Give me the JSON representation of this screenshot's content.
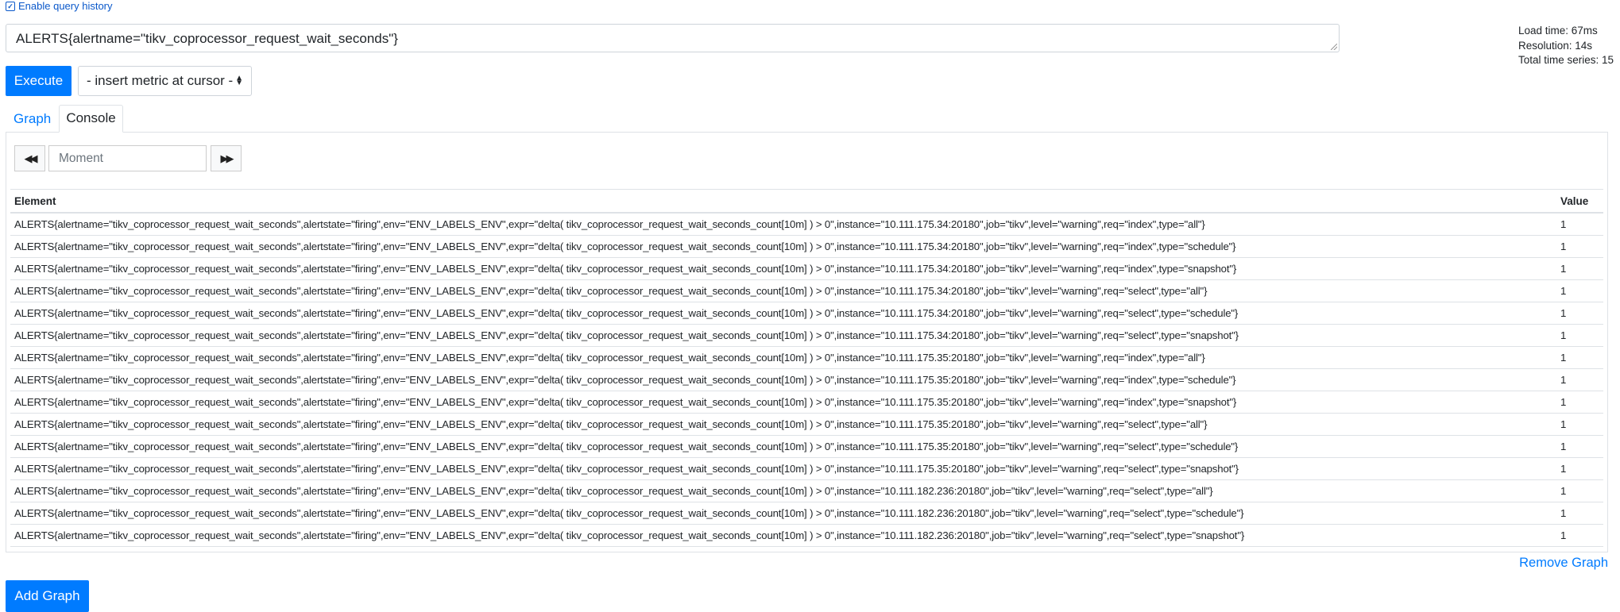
{
  "history": {
    "label": "Enable query history",
    "checked": true
  },
  "query": {
    "expression": "ALERTS{alertname=\"tikv_coprocessor_request_wait_seconds\"}"
  },
  "stats": {
    "load_time": "Load time: 67ms",
    "resolution": "Resolution: 14s",
    "total_series": "Total time series: 15"
  },
  "toolbar": {
    "execute_label": "Execute",
    "metric_select": "- insert metric at cursor -"
  },
  "tabs": [
    {
      "label": "Graph",
      "active": false
    },
    {
      "label": "Console",
      "active": true
    }
  ],
  "console": {
    "moment_placeholder": "Moment",
    "columns": [
      "Element",
      "Value"
    ],
    "rows": [
      {
        "element": "ALERTS{alertname=\"tikv_coprocessor_request_wait_seconds\",alertstate=\"firing\",env=\"ENV_LABELS_ENV\",expr=\"delta( tikv_coprocessor_request_wait_seconds_count[10m] ) > 0\",instance=\"10.111.175.34:20180\",job=\"tikv\",level=\"warning\",req=\"index\",type=\"all\"}",
        "value": "1"
      },
      {
        "element": "ALERTS{alertname=\"tikv_coprocessor_request_wait_seconds\",alertstate=\"firing\",env=\"ENV_LABELS_ENV\",expr=\"delta( tikv_coprocessor_request_wait_seconds_count[10m] ) > 0\",instance=\"10.111.175.34:20180\",job=\"tikv\",level=\"warning\",req=\"index\",type=\"schedule\"}",
        "value": "1"
      },
      {
        "element": "ALERTS{alertname=\"tikv_coprocessor_request_wait_seconds\",alertstate=\"firing\",env=\"ENV_LABELS_ENV\",expr=\"delta( tikv_coprocessor_request_wait_seconds_count[10m] ) > 0\",instance=\"10.111.175.34:20180\",job=\"tikv\",level=\"warning\",req=\"index\",type=\"snapshot\"}",
        "value": "1"
      },
      {
        "element": "ALERTS{alertname=\"tikv_coprocessor_request_wait_seconds\",alertstate=\"firing\",env=\"ENV_LABELS_ENV\",expr=\"delta( tikv_coprocessor_request_wait_seconds_count[10m] ) > 0\",instance=\"10.111.175.34:20180\",job=\"tikv\",level=\"warning\",req=\"select\",type=\"all\"}",
        "value": "1"
      },
      {
        "element": "ALERTS{alertname=\"tikv_coprocessor_request_wait_seconds\",alertstate=\"firing\",env=\"ENV_LABELS_ENV\",expr=\"delta( tikv_coprocessor_request_wait_seconds_count[10m] ) > 0\",instance=\"10.111.175.34:20180\",job=\"tikv\",level=\"warning\",req=\"select\",type=\"schedule\"}",
        "value": "1"
      },
      {
        "element": "ALERTS{alertname=\"tikv_coprocessor_request_wait_seconds\",alertstate=\"firing\",env=\"ENV_LABELS_ENV\",expr=\"delta( tikv_coprocessor_request_wait_seconds_count[10m] ) > 0\",instance=\"10.111.175.34:20180\",job=\"tikv\",level=\"warning\",req=\"select\",type=\"snapshot\"}",
        "value": "1"
      },
      {
        "element": "ALERTS{alertname=\"tikv_coprocessor_request_wait_seconds\",alertstate=\"firing\",env=\"ENV_LABELS_ENV\",expr=\"delta( tikv_coprocessor_request_wait_seconds_count[10m] ) > 0\",instance=\"10.111.175.35:20180\",job=\"tikv\",level=\"warning\",req=\"index\",type=\"all\"}",
        "value": "1"
      },
      {
        "element": "ALERTS{alertname=\"tikv_coprocessor_request_wait_seconds\",alertstate=\"firing\",env=\"ENV_LABELS_ENV\",expr=\"delta( tikv_coprocessor_request_wait_seconds_count[10m] ) > 0\",instance=\"10.111.175.35:20180\",job=\"tikv\",level=\"warning\",req=\"index\",type=\"schedule\"}",
        "value": "1"
      },
      {
        "element": "ALERTS{alertname=\"tikv_coprocessor_request_wait_seconds\",alertstate=\"firing\",env=\"ENV_LABELS_ENV\",expr=\"delta( tikv_coprocessor_request_wait_seconds_count[10m] ) > 0\",instance=\"10.111.175.35:20180\",job=\"tikv\",level=\"warning\",req=\"index\",type=\"snapshot\"}",
        "value": "1"
      },
      {
        "element": "ALERTS{alertname=\"tikv_coprocessor_request_wait_seconds\",alertstate=\"firing\",env=\"ENV_LABELS_ENV\",expr=\"delta( tikv_coprocessor_request_wait_seconds_count[10m] ) > 0\",instance=\"10.111.175.35:20180\",job=\"tikv\",level=\"warning\",req=\"select\",type=\"all\"}",
        "value": "1"
      },
      {
        "element": "ALERTS{alertname=\"tikv_coprocessor_request_wait_seconds\",alertstate=\"firing\",env=\"ENV_LABELS_ENV\",expr=\"delta( tikv_coprocessor_request_wait_seconds_count[10m] ) > 0\",instance=\"10.111.175.35:20180\",job=\"tikv\",level=\"warning\",req=\"select\",type=\"schedule\"}",
        "value": "1"
      },
      {
        "element": "ALERTS{alertname=\"tikv_coprocessor_request_wait_seconds\",alertstate=\"firing\",env=\"ENV_LABELS_ENV\",expr=\"delta( tikv_coprocessor_request_wait_seconds_count[10m] ) > 0\",instance=\"10.111.175.35:20180\",job=\"tikv\",level=\"warning\",req=\"select\",type=\"snapshot\"}",
        "value": "1"
      },
      {
        "element": "ALERTS{alertname=\"tikv_coprocessor_request_wait_seconds\",alertstate=\"firing\",env=\"ENV_LABELS_ENV\",expr=\"delta( tikv_coprocessor_request_wait_seconds_count[10m] ) > 0\",instance=\"10.111.182.236:20180\",job=\"tikv\",level=\"warning\",req=\"select\",type=\"all\"}",
        "value": "1"
      },
      {
        "element": "ALERTS{alertname=\"tikv_coprocessor_request_wait_seconds\",alertstate=\"firing\",env=\"ENV_LABELS_ENV\",expr=\"delta( tikv_coprocessor_request_wait_seconds_count[10m] ) > 0\",instance=\"10.111.182.236:20180\",job=\"tikv\",level=\"warning\",req=\"select\",type=\"schedule\"}",
        "value": "1"
      },
      {
        "element": "ALERTS{alertname=\"tikv_coprocessor_request_wait_seconds\",alertstate=\"firing\",env=\"ENV_LABELS_ENV\",expr=\"delta( tikv_coprocessor_request_wait_seconds_count[10m] ) > 0\",instance=\"10.111.182.236:20180\",job=\"tikv\",level=\"warning\",req=\"select\",type=\"snapshot\"}",
        "value": "1"
      }
    ]
  },
  "actions": {
    "remove_graph": "Remove Graph",
    "add_graph": "Add Graph"
  },
  "colors": {
    "primary": "#007bff",
    "border": "#dee2e6"
  }
}
